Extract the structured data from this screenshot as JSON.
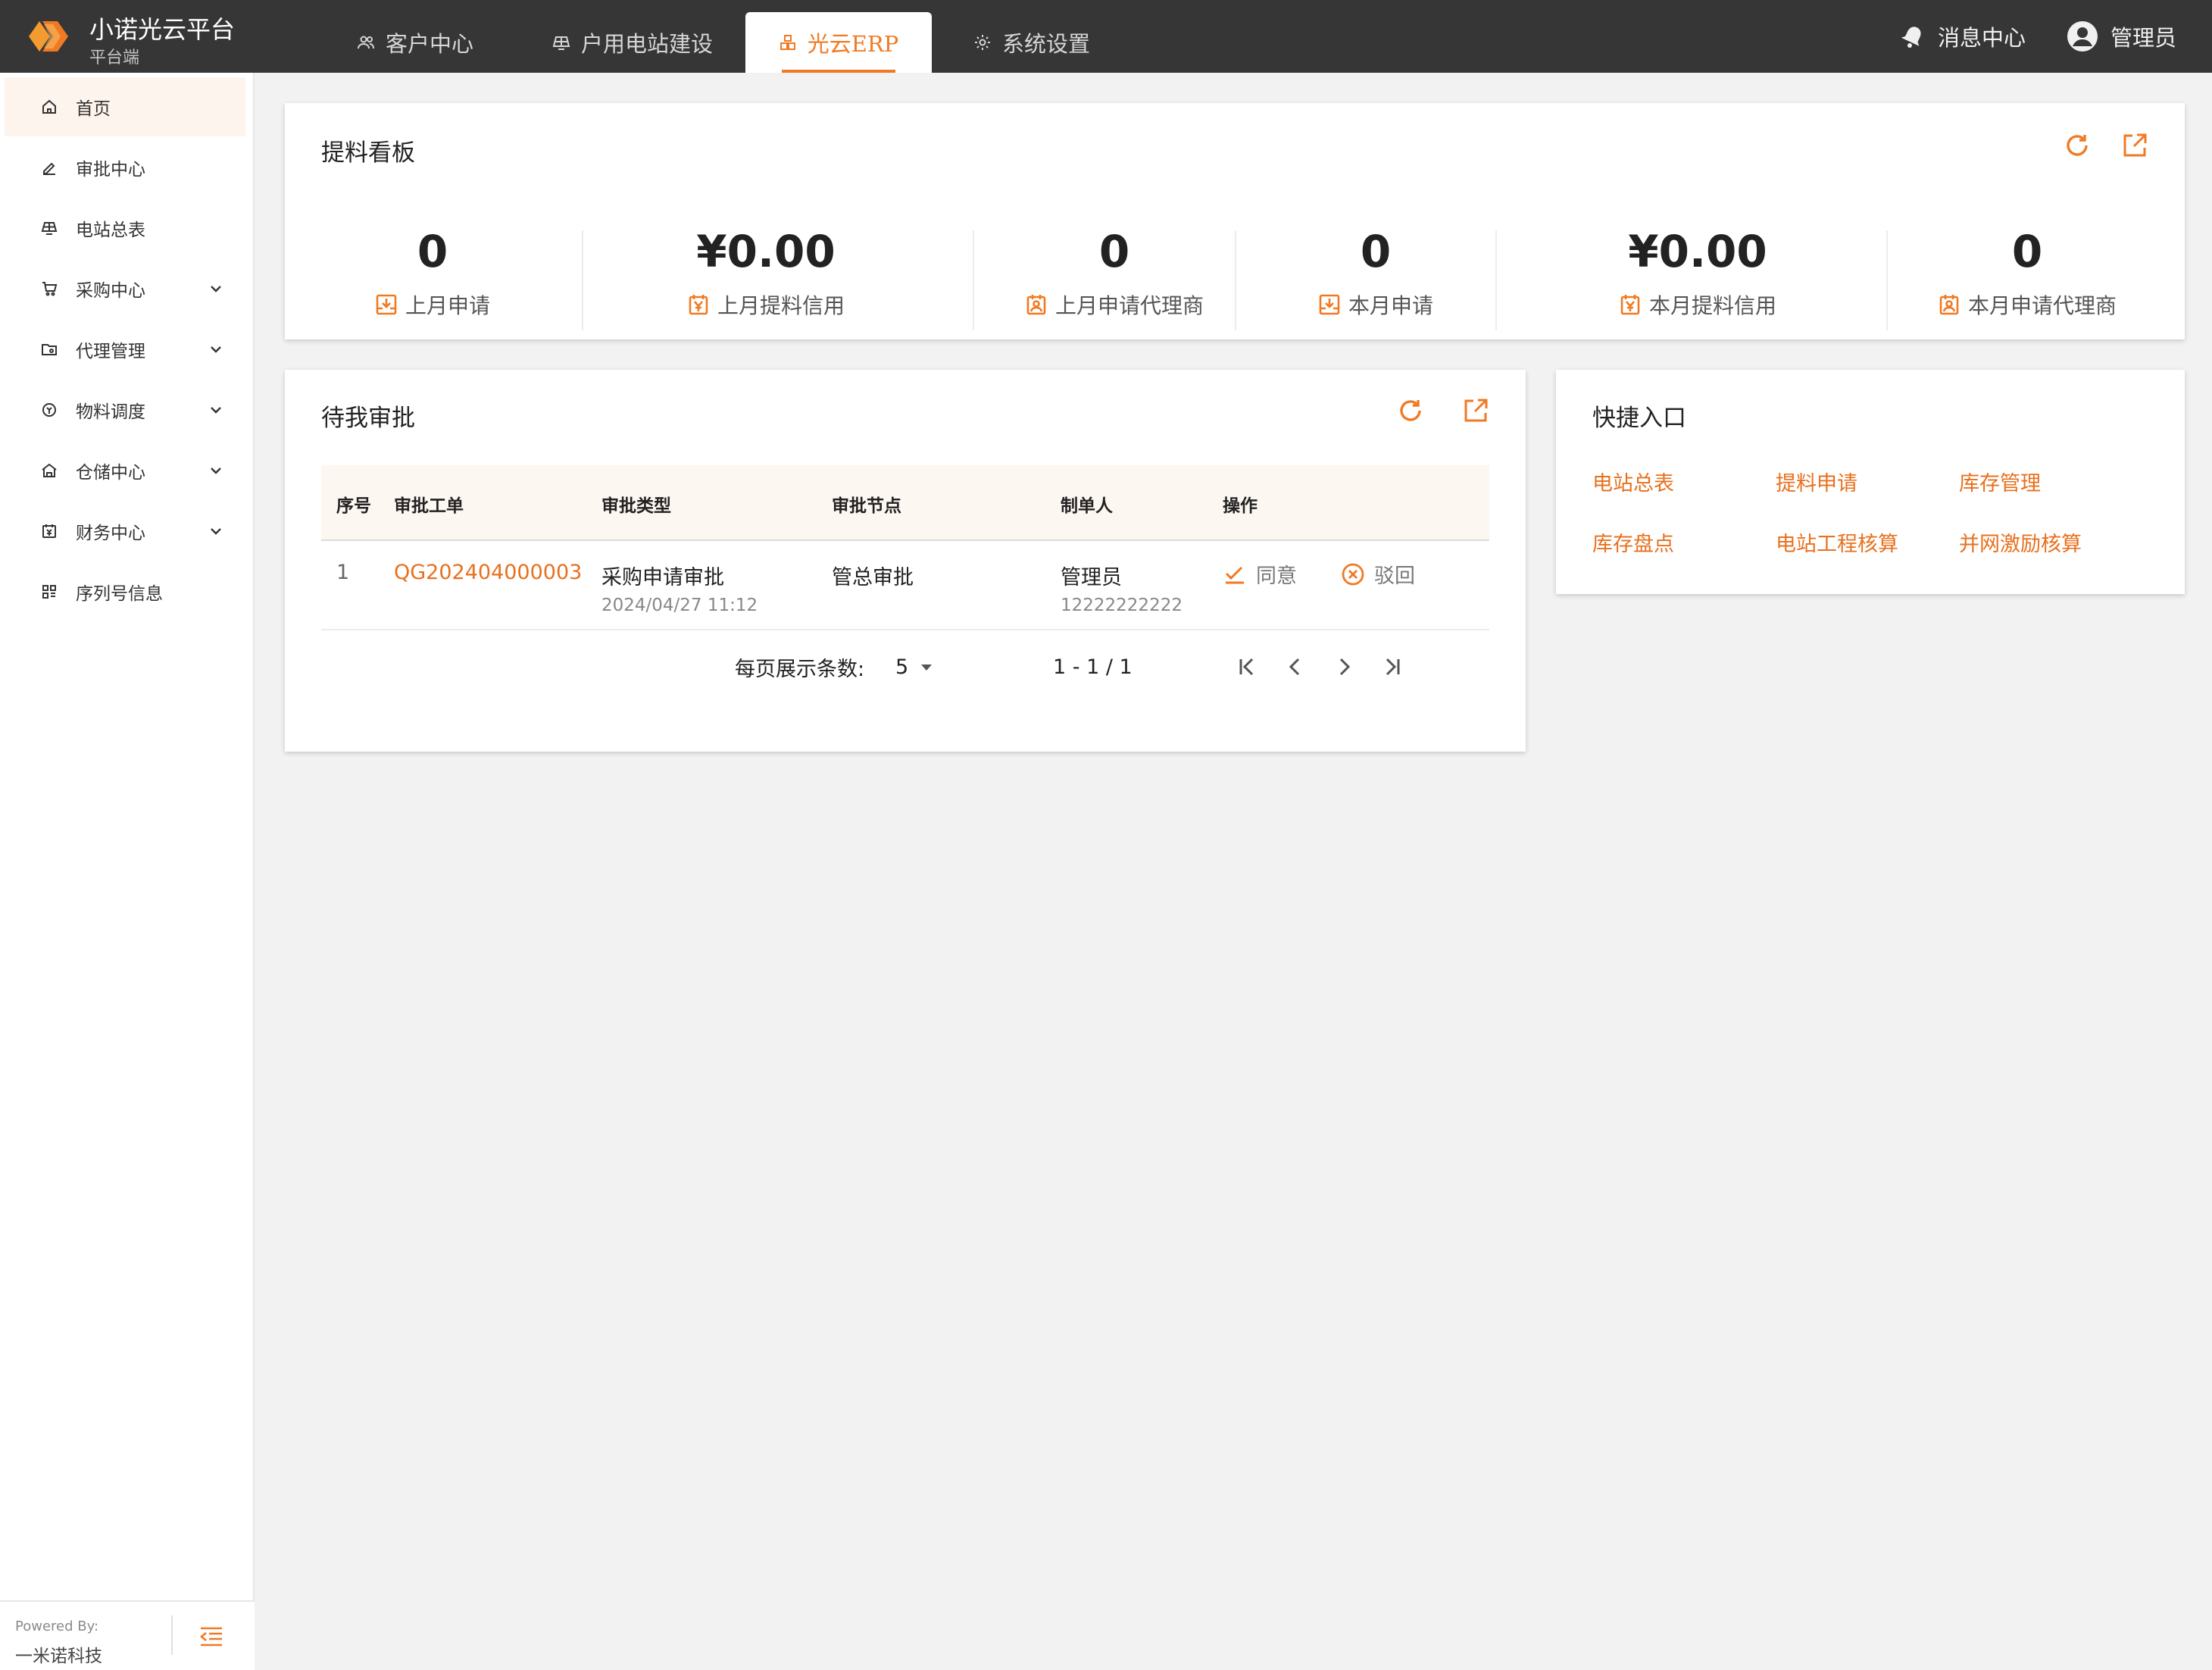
{
  "colors": {
    "accent": "#f07a23",
    "link": "#e8701e",
    "topbar": "#363636"
  },
  "app": {
    "title": "小诺光云平台",
    "subtitle": "平台端"
  },
  "nav": {
    "tabs": [
      {
        "label": "客户中心",
        "icon": "users-icon"
      },
      {
        "label": "户用电站建设",
        "icon": "solar-panel-icon"
      },
      {
        "label": "光云ERP",
        "icon": "cubes-icon",
        "active": true
      },
      {
        "label": "系统设置",
        "icon": "gear-icon"
      }
    ],
    "messages_label": "消息中心",
    "user_label": "管理员"
  },
  "sidebar": {
    "items": [
      {
        "label": "首页",
        "icon": "home-icon",
        "active": true
      },
      {
        "label": "审批中心",
        "icon": "pen-icon"
      },
      {
        "label": "电站总表",
        "icon": "solar-panel-icon"
      },
      {
        "label": "采购中心",
        "icon": "cart-icon",
        "expandable": true
      },
      {
        "label": "代理管理",
        "icon": "folder-icon",
        "expandable": true
      },
      {
        "label": "物料调度",
        "icon": "dispatch-icon",
        "expandable": true
      },
      {
        "label": "仓储中心",
        "icon": "warehouse-icon",
        "expandable": true
      },
      {
        "label": "财务中心",
        "icon": "finance-icon",
        "expandable": true
      },
      {
        "label": "序列号信息",
        "icon": "grid-icon"
      }
    ],
    "powered_by": "Powered By:",
    "company": "一米诺科技"
  },
  "dashboard": {
    "title": "提料看板",
    "stats": [
      {
        "value": "0",
        "label": "上月申请",
        "icon": "download-box-icon"
      },
      {
        "value": "¥0.00",
        "label": "上月提料信用",
        "icon": "yen-calendar-icon"
      },
      {
        "value": "0",
        "label": "上月申请代理商",
        "icon": "agent-badge-icon"
      },
      {
        "value": "0",
        "label": "本月申请",
        "icon": "download-box-icon"
      },
      {
        "value": "¥0.00",
        "label": "本月提料信用",
        "icon": "yen-calendar-icon"
      },
      {
        "value": "0",
        "label": "本月申请代理商",
        "icon": "agent-badge-icon"
      }
    ]
  },
  "approvals": {
    "title": "待我审批",
    "columns": [
      "序号",
      "审批工单",
      "审批类型",
      "审批节点",
      "制单人",
      "操作"
    ],
    "rows": [
      {
        "index": "1",
        "order_no": "QG202404000003",
        "type": "采购申请审批",
        "created_at": "2024/04/27 11:12",
        "node": "管总审批",
        "creator": "管理员",
        "creator_phone": "12222222222",
        "approve_label": "同意",
        "reject_label": "驳回"
      }
    ],
    "pagination": {
      "per_page_label": "每页展示条数:",
      "per_page": "5",
      "range": "1 - 1 / 1"
    }
  },
  "quick": {
    "title": "快捷入口",
    "links": [
      "电站总表",
      "提料申请",
      "库存管理",
      "库存盘点",
      "电站工程核算",
      "并网激励核算"
    ]
  }
}
